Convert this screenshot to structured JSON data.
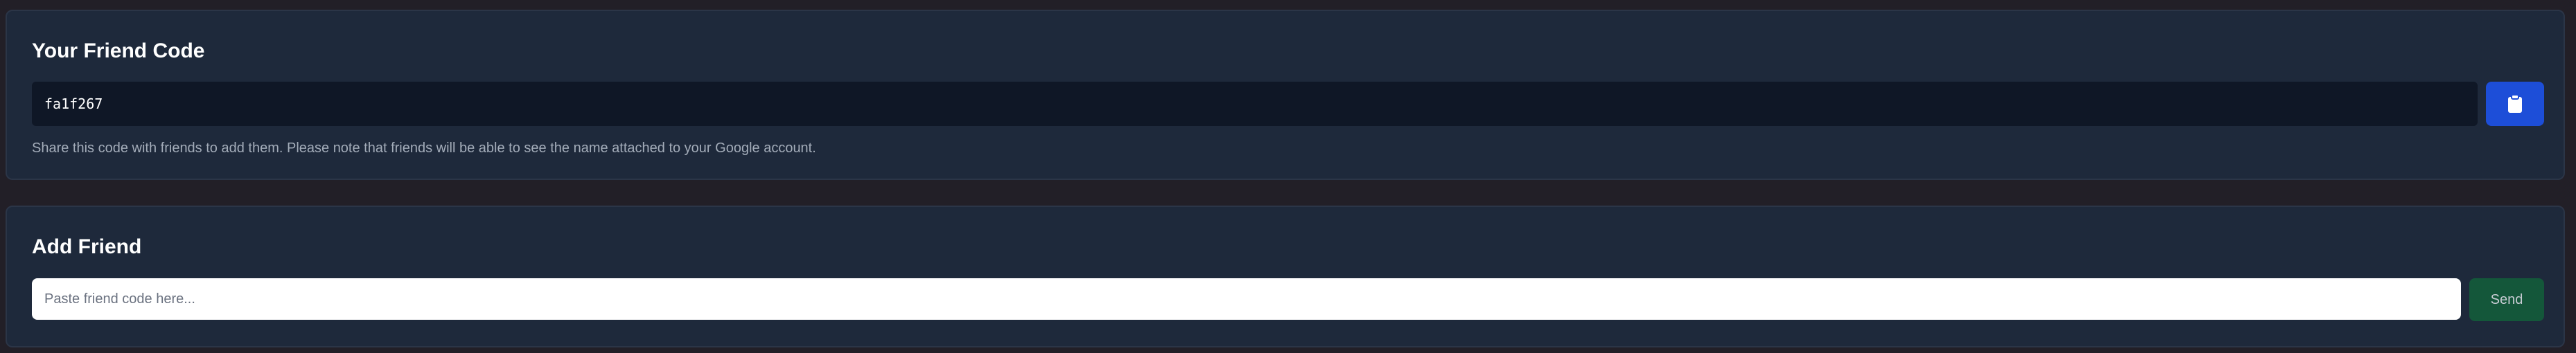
{
  "friend_code_panel": {
    "title": "Your Friend Code",
    "code": "fa1f267",
    "copy_icon": "clipboard-icon",
    "helper_text": "Share this code with friends to add them. Please note that friends will be able to see the name attached to your Google account."
  },
  "add_friend_panel": {
    "title": "Add Friend",
    "input_value": "",
    "input_placeholder": "Paste friend code here...",
    "send_label": "Send"
  },
  "colors": {
    "background": "#221f27",
    "panel": "#1e293b",
    "code_field": "#0f1726",
    "copy_button": "#1d4ed8",
    "send_button": "#14573a"
  }
}
